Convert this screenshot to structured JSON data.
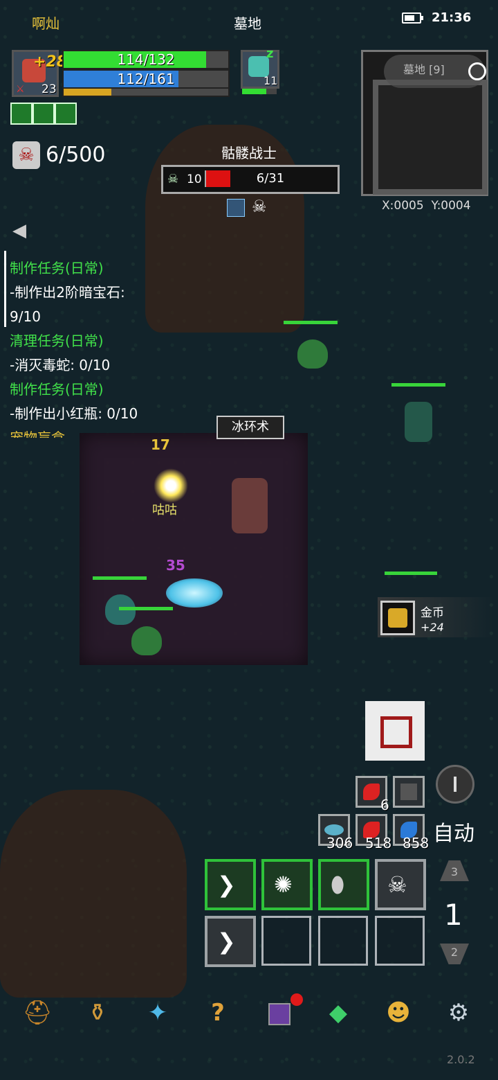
{
  "status_bar": {
    "player_name": "啊灿",
    "map_name": "墓地",
    "time": "21:36"
  },
  "player": {
    "buff_bonus": "+28",
    "level": "23",
    "hp_text": "114/132",
    "hp_fraction": 0.864,
    "mp_text": "112/161",
    "mp_fraction": 0.696,
    "xp_fraction": 0.29
  },
  "pet": {
    "level": "11",
    "sleep_icon": "z"
  },
  "kills": {
    "text": "6/500"
  },
  "target": {
    "name": "骷髅战士",
    "level": "10",
    "hp_text": "6/31",
    "hp_fraction": 0.19
  },
  "minimap": {
    "label": "墓地 [9]",
    "coords": "X:0005  Y:0004"
  },
  "quests": [
    {
      "title": "制作任务(日常)",
      "line1": "-制作出2阶暗宝石:",
      "line2": "9/10"
    },
    {
      "title": "清理任务(日常)",
      "line1": "-消灭毒蛇: 0/10"
    },
    {
      "title": "制作任务(日常)",
      "line1": "-制作出小红瓶: 0/10"
    },
    {
      "title": "宠物盲盒"
    }
  ],
  "combat": {
    "skill_cast": "冰环术",
    "damage_top": "17",
    "damage_mid": "35",
    "enemy_label": "咕咕"
  },
  "loot": {
    "name": "金币",
    "amount": "+24"
  },
  "potions": {
    "red_small_count": "6",
    "fish_count": "306",
    "red_count": "518",
    "blue_count": "858"
  },
  "auto_label": "自动",
  "skill_page": {
    "up": "3",
    "current": "1",
    "down": "2"
  },
  "version": "2.0.2",
  "colors": {
    "hp": "#33dd33",
    "mp": "#2f7fd8",
    "xp": "#d8a522",
    "target_hp": "#dd1111",
    "quest_title": "#41e24a"
  },
  "nav": [
    "helmet-icon",
    "bag-icon",
    "gem-icon",
    "question-icon",
    "shop-icon",
    "diamond-icon",
    "pet-icon",
    "gear-icon"
  ]
}
